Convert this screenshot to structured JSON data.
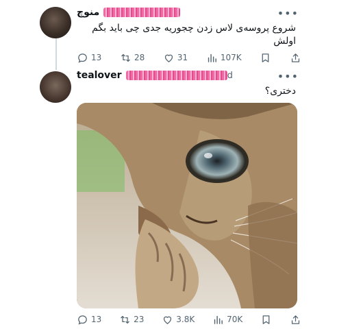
{
  "tweets": [
    {
      "name": "منوچ",
      "handle": "",
      "text": "شروع پروسه‌ی لاس زدن چجوریه جدی چی باید بگم اولش",
      "stats": {
        "replies": "13",
        "retweets": "28",
        "likes": "31",
        "views": "107K"
      }
    },
    {
      "name": "tealover",
      "handle_suffix": "d",
      "text": "دختری؟",
      "stats": {
        "replies": "13",
        "retweets": "23",
        "likes": "3.8K",
        "views": "70K"
      }
    }
  ],
  "icons": [
    "reply-icon",
    "retweet-icon",
    "like-icon",
    "views-icon",
    "bookmark-icon",
    "share-icon",
    "more-icon"
  ],
  "colors": {
    "text": "#0f1419",
    "muted": "#536471",
    "line": "#cfd9de",
    "scribble": "#f26aa5"
  }
}
